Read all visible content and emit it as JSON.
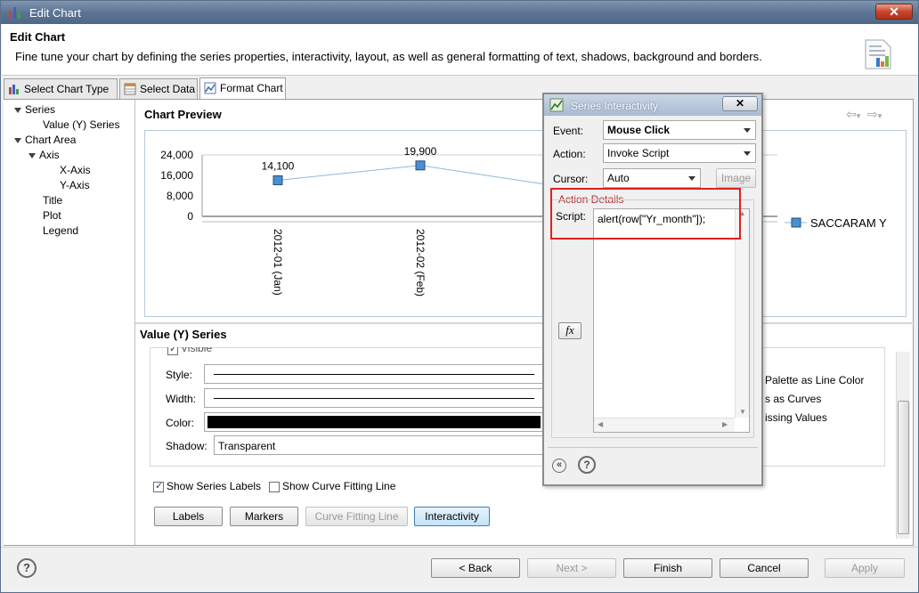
{
  "window": {
    "title": "Edit Chart",
    "close_label": "✕"
  },
  "header": {
    "title": "Edit Chart",
    "description": "Fine tune your chart by defining the series properties, interactivity, layout, as well as general formatting of text, shadows, background and borders."
  },
  "tabs": [
    {
      "label": "Select Chart Type"
    },
    {
      "label": "Select Data"
    },
    {
      "label": "Format Chart"
    }
  ],
  "tree": {
    "series": "Series",
    "value_series": "Value (Y) Series",
    "chart_area": "Chart Area",
    "axis": "Axis",
    "x_axis": "X-Axis",
    "y_axis": "Y-Axis",
    "title": "Title",
    "plot": "Plot",
    "legend": "Legend"
  },
  "preview": {
    "title": "Chart Preview",
    "nav_back": "⇦",
    "nav_fwd": "⇨"
  },
  "chart_data": {
    "type": "line",
    "categories": [
      "2012-01 (Jan)",
      "2012-02 (Feb)"
    ],
    "series": [
      {
        "name": "SACCARAM Y",
        "values": [
          14100,
          19900
        ]
      }
    ],
    "data_labels": [
      "14,100",
      "19,900"
    ],
    "y_ticks": [
      "24,000",
      "16,000",
      "8,000",
      "0"
    ],
    "ylim": [
      0,
      24000
    ],
    "legend": "right",
    "colors": {
      "line": "#8fb8d8",
      "marker": "#4a90d0"
    }
  },
  "series_section": {
    "title": "Value (Y) Series",
    "visible": "Visible",
    "style_label": "Style:",
    "width_label": "Width:",
    "color_label": "Color:",
    "shadow_label": "Shadow:",
    "shadow_value": "Transparent",
    "palette_as_line_color": "Palette as Line Color",
    "as_curves": "s as Curves",
    "missing_values": "issing Values",
    "show_series_labels": "Show Series Labels",
    "show_curve_fitting_line": "Show Curve Fitting Line"
  },
  "buttons": {
    "labels": "Labels",
    "markers": "Markers",
    "curve_fitting_line": "Curve Fitting Line",
    "interactivity": "Interactivity"
  },
  "footer": {
    "help": "?",
    "back": "< Back",
    "next": "Next >",
    "finish": "Finish",
    "cancel": "Cancel",
    "apply": "Apply"
  },
  "dialog": {
    "title": "Series Interactivity",
    "close_label": "✕",
    "event_label": "Event:",
    "event_value": "Mouse Click",
    "action_label": "Action:",
    "action_value": "Invoke Script",
    "cursor_label": "Cursor:",
    "cursor_value": "Auto",
    "image_button": "Image",
    "action_details": "Action Details",
    "script_label": "Script:",
    "script_value": "alert(row[\"Yr_month\"]);",
    "fx_label": "fx",
    "collapse_label": "«",
    "help_label": "?"
  }
}
